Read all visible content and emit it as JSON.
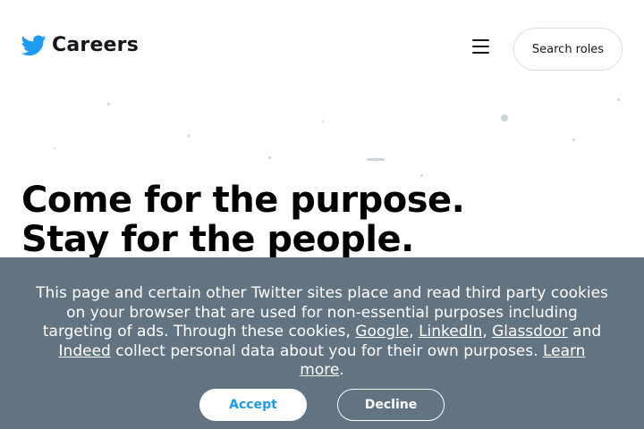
{
  "header": {
    "logo_icon": "twitter-bird-icon",
    "brand_text": "Careers",
    "menu_icon": "hamburger-menu-icon",
    "search_label": "Search roles"
  },
  "hero": {
    "line1": "Come for the purpose.",
    "line2": "Stay for the people."
  },
  "cookie_banner": {
    "text_part1": "This page and certain other Twitter sites place and read third party cookies on your browser that are used for non-essential purposes including targeting of ads. Through these cookies,",
    "link_google": "Google",
    "sep1": ",",
    "link_linkedin": "LinkedIn",
    "sep2": ",",
    "link_glassdoor": "Glassdoor",
    "and_word": "and",
    "link_indeed": "Indeed",
    "text_part2": "collect personal data about you for their own purposes.",
    "link_learn_more": "Learn more",
    "period": ".",
    "accept_label": "Accept",
    "decline_label": "Decline"
  },
  "colors": {
    "brand_blue": "#1d9bf0",
    "banner_bg": "#627482",
    "text_dark": "#14171a"
  }
}
